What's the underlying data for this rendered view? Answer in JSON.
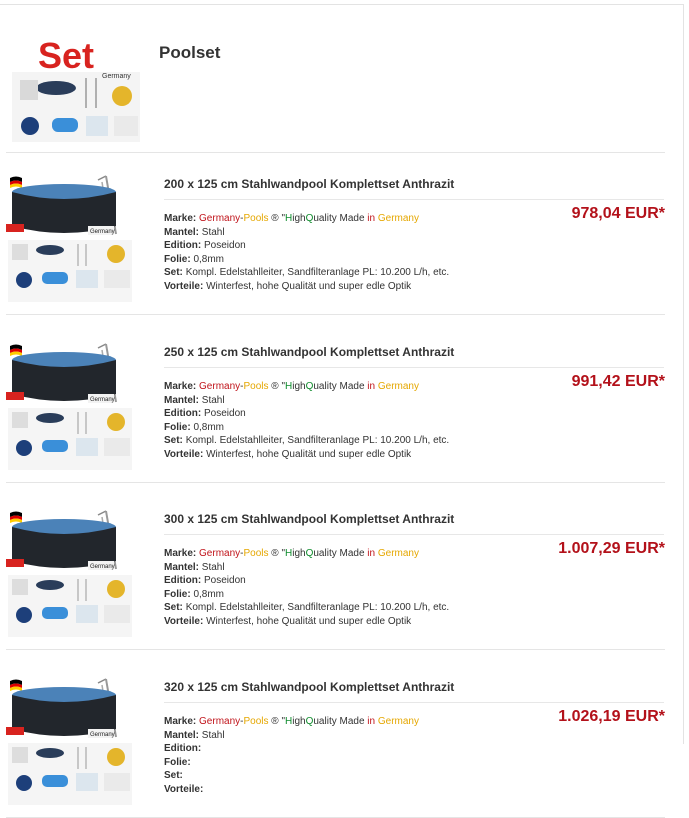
{
  "category": {
    "title": "Poolset",
    "image_label": "Set"
  },
  "labels": {
    "brand": "Marke:",
    "mantel": "Mantel:",
    "edition": "Edition:",
    "folie": "Folie:",
    "set": "Set:",
    "vorteile": "Vorteile:"
  },
  "brand_parts": {
    "germany": "Germany",
    "dash": "-",
    "pools": "Pools",
    "reg": " ® \"",
    "h": "H",
    "igh": "igh",
    "q": "Q",
    "uality_made": "uality Made ",
    "in": "in",
    "space": " ",
    "germany2": "Germany"
  },
  "products": [
    {
      "title": "200 x 125 cm Stahlwandpool Komplettset Anthrazit",
      "mantel": "Stahl",
      "edition": "Poseidon",
      "folie": "0,8mm",
      "set": "Kompl. Edelstahlleiter, Sandfilteranlage PL: 10.200 L/h, etc.",
      "vorteile": "Winterfest, hohe Qualität und super edle Optik",
      "price": "978,04 EUR*"
    },
    {
      "title": "250 x 125 cm Stahlwandpool Komplettset Anthrazit",
      "mantel": "Stahl",
      "edition": "Poseidon",
      "folie": "0,8mm",
      "set": "Kompl. Edelstahlleiter, Sandfilteranlage PL: 10.200 L/h, etc.",
      "vorteile": "Winterfest, hohe Qualität und super edle Optik",
      "price": "991,42 EUR*"
    },
    {
      "title": "300 x 125 cm Stahlwandpool Komplettset Anthrazit",
      "mantel": "Stahl",
      "edition": "Poseidon",
      "folie": "0,8mm",
      "set": "Kompl. Edelstahlleiter, Sandfilteranlage PL: 10.200 L/h, etc.",
      "vorteile": "Winterfest, hohe Qualität und super edle Optik",
      "price": "1.007,29 EUR*"
    },
    {
      "title": "320 x 125 cm Stahlwandpool Komplettset Anthrazit",
      "mantel": "Stahl",
      "edition": "",
      "folie": "",
      "set": "",
      "vorteile": "",
      "price": "1.026,19 EUR*"
    }
  ],
  "colors": {
    "price": "#b3111a",
    "brand_red": "#c0131a",
    "brand_yellow": "#e5a700",
    "brand_green": "#0d8b2b"
  }
}
